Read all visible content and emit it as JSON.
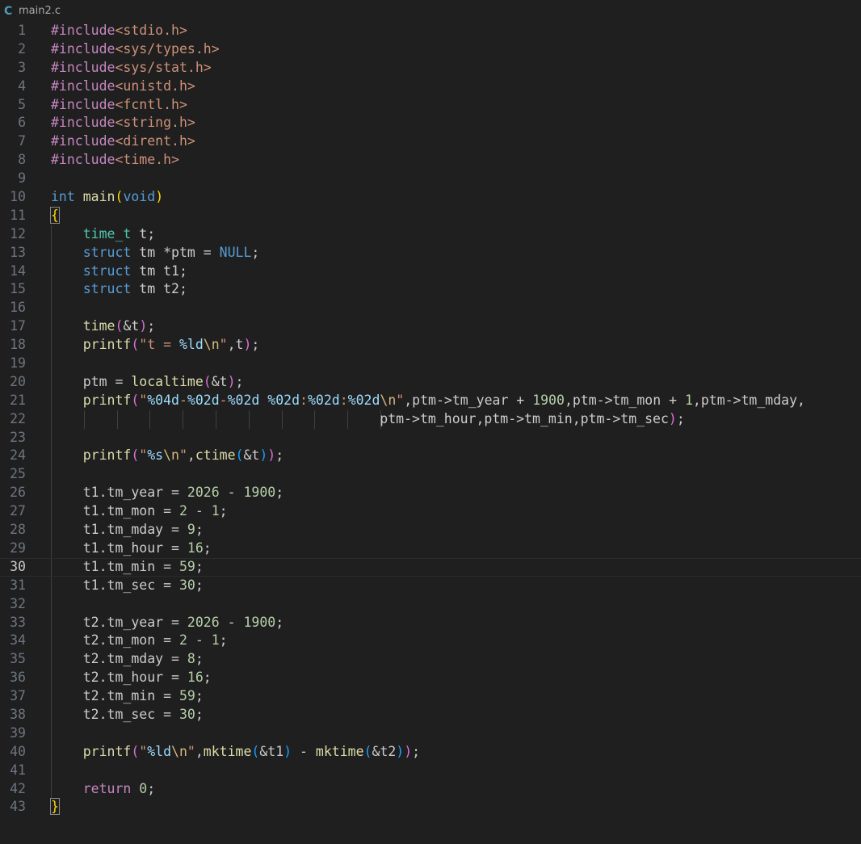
{
  "tab": {
    "icon": "C",
    "filename": "main2.c"
  },
  "editor": {
    "current_line": 30,
    "lines": [
      {
        "n": "1",
        "tokens": [
          [
            "#include",
            "ctrl"
          ],
          [
            "<stdio.h>",
            "str"
          ]
        ]
      },
      {
        "n": "2",
        "tokens": [
          [
            "#include",
            "ctrl"
          ],
          [
            "<sys/types.h>",
            "str"
          ]
        ]
      },
      {
        "n": "3",
        "tokens": [
          [
            "#include",
            "ctrl"
          ],
          [
            "<sys/stat.h>",
            "str"
          ]
        ]
      },
      {
        "n": "4",
        "tokens": [
          [
            "#include",
            "ctrl"
          ],
          [
            "<unistd.h>",
            "str"
          ]
        ]
      },
      {
        "n": "5",
        "tokens": [
          [
            "#include",
            "ctrl"
          ],
          [
            "<fcntl.h>",
            "str"
          ]
        ]
      },
      {
        "n": "6",
        "tokens": [
          [
            "#include",
            "ctrl"
          ],
          [
            "<string.h>",
            "str"
          ]
        ]
      },
      {
        "n": "7",
        "tokens": [
          [
            "#include",
            "ctrl"
          ],
          [
            "<dirent.h>",
            "str"
          ]
        ]
      },
      {
        "n": "8",
        "tokens": [
          [
            "#include",
            "ctrl"
          ],
          [
            "<time.h>",
            "str"
          ]
        ]
      },
      {
        "n": "9",
        "tokens": []
      },
      {
        "n": "10",
        "tokens": [
          [
            "int",
            "kw"
          ],
          [
            " ",
            "plain"
          ],
          [
            "main",
            "fn"
          ],
          [
            "(",
            "b1"
          ],
          [
            "void",
            "kw"
          ],
          [
            ")",
            "b1"
          ]
        ]
      },
      {
        "n": "11",
        "tokens": [
          [
            "{",
            "b1match"
          ]
        ]
      },
      {
        "n": "12",
        "tokens": [
          [
            "    ",
            "plain"
          ],
          [
            "time_t",
            "type"
          ],
          [
            " t;",
            "plain"
          ]
        ]
      },
      {
        "n": "13",
        "tokens": [
          [
            "    ",
            "plain"
          ],
          [
            "struct",
            "kw"
          ],
          [
            " tm *ptm = ",
            "plain"
          ],
          [
            "NULL",
            "kw"
          ],
          [
            ";",
            "plain"
          ]
        ]
      },
      {
        "n": "14",
        "tokens": [
          [
            "    ",
            "plain"
          ],
          [
            "struct",
            "kw"
          ],
          [
            " tm t1;",
            "plain"
          ]
        ]
      },
      {
        "n": "15",
        "tokens": [
          [
            "    ",
            "plain"
          ],
          [
            "struct",
            "kw"
          ],
          [
            " tm t2;",
            "plain"
          ]
        ]
      },
      {
        "n": "16",
        "tokens": []
      },
      {
        "n": "17",
        "tokens": [
          [
            "    ",
            "plain"
          ],
          [
            "time",
            "fn"
          ],
          [
            "(",
            "b2"
          ],
          [
            "&t",
            "plain"
          ],
          [
            ")",
            "b2"
          ],
          [
            ";",
            "plain"
          ]
        ]
      },
      {
        "n": "18",
        "tokens": [
          [
            "    ",
            "plain"
          ],
          [
            "printf",
            "fn"
          ],
          [
            "(",
            "b2"
          ],
          [
            "\"t = ",
            "str"
          ],
          [
            "%ld",
            "var"
          ],
          [
            "\\n",
            "esc"
          ],
          [
            "\"",
            "str"
          ],
          [
            ",t",
            "plain"
          ],
          [
            ")",
            "b2"
          ],
          [
            ";",
            "plain"
          ]
        ]
      },
      {
        "n": "19",
        "tokens": []
      },
      {
        "n": "20",
        "tokens": [
          [
            "    ptm = ",
            "plain"
          ],
          [
            "localtime",
            "fn"
          ],
          [
            "(",
            "b2"
          ],
          [
            "&t",
            "plain"
          ],
          [
            ")",
            "b2"
          ],
          [
            ";",
            "plain"
          ]
        ]
      },
      {
        "n": "21",
        "tokens": [
          [
            "    ",
            "plain"
          ],
          [
            "printf",
            "fn"
          ],
          [
            "(",
            "b2"
          ],
          [
            "\"",
            "str"
          ],
          [
            "%04d",
            "var"
          ],
          [
            "-",
            "str"
          ],
          [
            "%02d",
            "var"
          ],
          [
            "-",
            "str"
          ],
          [
            "%02d",
            "var"
          ],
          [
            " ",
            "str"
          ],
          [
            "%02d",
            "var"
          ],
          [
            ":",
            "str"
          ],
          [
            "%02d",
            "var"
          ],
          [
            ":",
            "str"
          ],
          [
            "%02d",
            "var"
          ],
          [
            "\\n",
            "esc"
          ],
          [
            "\"",
            "str"
          ],
          [
            ",ptm->tm_year + ",
            "plain"
          ],
          [
            "1900",
            "num"
          ],
          [
            ",ptm->tm_mon + ",
            "plain"
          ],
          [
            "1",
            "num"
          ],
          [
            ",ptm->tm_mday,",
            "plain"
          ]
        ]
      },
      {
        "n": "22",
        "tokens": [
          [
            "                                         ptm->tm_hour,ptm->tm_min,ptm->tm_sec",
            "plain"
          ],
          [
            ")",
            "b2"
          ],
          [
            ";",
            "plain"
          ]
        ]
      },
      {
        "n": "23",
        "tokens": []
      },
      {
        "n": "24",
        "tokens": [
          [
            "    ",
            "plain"
          ],
          [
            "printf",
            "fn"
          ],
          [
            "(",
            "b2"
          ],
          [
            "\"",
            "str"
          ],
          [
            "%s",
            "var"
          ],
          [
            "\\n",
            "esc"
          ],
          [
            "\"",
            "str"
          ],
          [
            ",",
            "plain"
          ],
          [
            "ctime",
            "fn"
          ],
          [
            "(",
            "b3"
          ],
          [
            "&t",
            "plain"
          ],
          [
            ")",
            "b3"
          ],
          [
            ")",
            "b2"
          ],
          [
            ";",
            "plain"
          ]
        ]
      },
      {
        "n": "25",
        "tokens": []
      },
      {
        "n": "26",
        "tokens": [
          [
            "    t1.tm_year = ",
            "plain"
          ],
          [
            "2026",
            "num"
          ],
          [
            " - ",
            "plain"
          ],
          [
            "1900",
            "num"
          ],
          [
            ";",
            "plain"
          ]
        ]
      },
      {
        "n": "27",
        "tokens": [
          [
            "    t1.tm_mon = ",
            "plain"
          ],
          [
            "2",
            "num"
          ],
          [
            " - ",
            "plain"
          ],
          [
            "1",
            "num"
          ],
          [
            ";",
            "plain"
          ]
        ]
      },
      {
        "n": "28",
        "tokens": [
          [
            "    t1.tm_mday = ",
            "plain"
          ],
          [
            "9",
            "num"
          ],
          [
            ";",
            "plain"
          ]
        ]
      },
      {
        "n": "29",
        "tokens": [
          [
            "    t1.tm_hour = ",
            "plain"
          ],
          [
            "16",
            "num"
          ],
          [
            ";",
            "plain"
          ]
        ]
      },
      {
        "n": "30",
        "tokens": [
          [
            "    t1.tm_min = ",
            "plain"
          ],
          [
            "59",
            "num"
          ],
          [
            ";",
            "plain"
          ]
        ]
      },
      {
        "n": "31",
        "tokens": [
          [
            "    t1.tm_sec = ",
            "plain"
          ],
          [
            "30",
            "num"
          ],
          [
            ";",
            "plain"
          ]
        ]
      },
      {
        "n": "32",
        "tokens": []
      },
      {
        "n": "33",
        "tokens": [
          [
            "    t2.tm_year = ",
            "plain"
          ],
          [
            "2026",
            "num"
          ],
          [
            " - ",
            "plain"
          ],
          [
            "1900",
            "num"
          ],
          [
            ";",
            "plain"
          ]
        ]
      },
      {
        "n": "34",
        "tokens": [
          [
            "    t2.tm_mon = ",
            "plain"
          ],
          [
            "2",
            "num"
          ],
          [
            " - ",
            "plain"
          ],
          [
            "1",
            "num"
          ],
          [
            ";",
            "plain"
          ]
        ]
      },
      {
        "n": "35",
        "tokens": [
          [
            "    t2.tm_mday = ",
            "plain"
          ],
          [
            "8",
            "num"
          ],
          [
            ";",
            "plain"
          ]
        ]
      },
      {
        "n": "36",
        "tokens": [
          [
            "    t2.tm_hour = ",
            "plain"
          ],
          [
            "16",
            "num"
          ],
          [
            ";",
            "plain"
          ]
        ]
      },
      {
        "n": "37",
        "tokens": [
          [
            "    t2.tm_min = ",
            "plain"
          ],
          [
            "59",
            "num"
          ],
          [
            ";",
            "plain"
          ]
        ]
      },
      {
        "n": "38",
        "tokens": [
          [
            "    t2.tm_sec = ",
            "plain"
          ],
          [
            "30",
            "num"
          ],
          [
            ";",
            "plain"
          ]
        ]
      },
      {
        "n": "39",
        "tokens": []
      },
      {
        "n": "40",
        "tokens": [
          [
            "    ",
            "plain"
          ],
          [
            "printf",
            "fn"
          ],
          [
            "(",
            "b2"
          ],
          [
            "\"",
            "str"
          ],
          [
            "%ld",
            "var"
          ],
          [
            "\\n",
            "esc"
          ],
          [
            "\"",
            "str"
          ],
          [
            ",",
            "plain"
          ],
          [
            "mktime",
            "fn"
          ],
          [
            "(",
            "b3"
          ],
          [
            "&t1",
            "plain"
          ],
          [
            ")",
            "b3"
          ],
          [
            " - ",
            "plain"
          ],
          [
            "mktime",
            "fn"
          ],
          [
            "(",
            "b3"
          ],
          [
            "&t2",
            "plain"
          ],
          [
            ")",
            "b3"
          ],
          [
            ")",
            "b2"
          ],
          [
            ";",
            "plain"
          ]
        ]
      },
      {
        "n": "41",
        "tokens": []
      },
      {
        "n": "42",
        "tokens": [
          [
            "    ",
            "plain"
          ],
          [
            "return",
            "ctrl"
          ],
          [
            " ",
            "plain"
          ],
          [
            "0",
            "num"
          ],
          [
            ";",
            "plain"
          ]
        ]
      },
      {
        "n": "43",
        "tokens": [
          [
            "}",
            "b1match"
          ]
        ]
      }
    ]
  },
  "colors": {
    "background": "#1f1f1f",
    "keyword": "#569cd6",
    "control": "#c586c0",
    "function": "#dcdcaa",
    "string": "#ce9178",
    "number": "#b5cea8"
  }
}
